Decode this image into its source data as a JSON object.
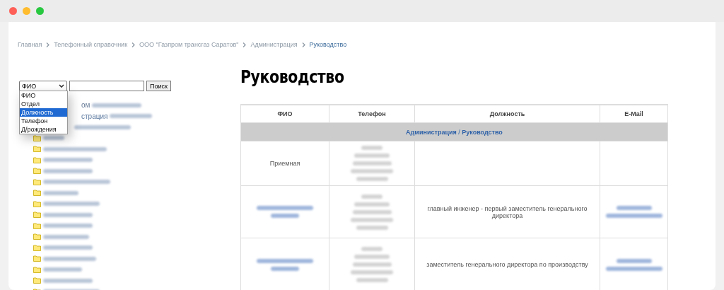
{
  "breadcrumbs": [
    {
      "label": "Главная",
      "current": false
    },
    {
      "label": "Телефонный справочник",
      "current": false
    },
    {
      "label": "ООО \"Газпром трансгаз Саратов\"",
      "current": false
    },
    {
      "label": "Администрация",
      "current": false
    },
    {
      "label": "Руководство",
      "current": true
    }
  ],
  "search": {
    "field": "ФИО",
    "button": "Поиск",
    "options": [
      {
        "label": "ФИО",
        "selected": false
      },
      {
        "label": "Отдел",
        "selected": false
      },
      {
        "label": "Должность",
        "selected": true
      },
      {
        "label": "Телефон",
        "selected": false
      },
      {
        "label": "Д/рождения",
        "selected": false
      }
    ]
  },
  "tree": [
    {
      "text": "ом",
      "kind": "partial"
    },
    {
      "text": "страция",
      "kind": "partial"
    },
    {
      "kind": "covered"
    },
    {
      "kind": "folder"
    },
    {
      "kind": "folder"
    },
    {
      "kind": "folder"
    },
    {
      "kind": "folder"
    },
    {
      "kind": "folder"
    },
    {
      "kind": "folder"
    },
    {
      "kind": "folder"
    },
    {
      "kind": "folder"
    },
    {
      "kind": "folder"
    },
    {
      "kind": "folder"
    },
    {
      "kind": "folder"
    },
    {
      "kind": "folder"
    },
    {
      "kind": "folder"
    },
    {
      "kind": "folder"
    },
    {
      "kind": "folder"
    }
  ],
  "page_title": "Руководство",
  "table": {
    "columns": [
      "ФИО",
      "Телефон",
      "Должность",
      "E-Mail"
    ],
    "group": {
      "department": "Администрация",
      "separator": "/",
      "section": "Руководство"
    },
    "rows": [
      {
        "name": "Приемная",
        "position": ""
      },
      {
        "position": "главный инженер - первый заместитель генерального директора"
      },
      {
        "position": "заместитель генерального директора по производству"
      }
    ]
  }
}
